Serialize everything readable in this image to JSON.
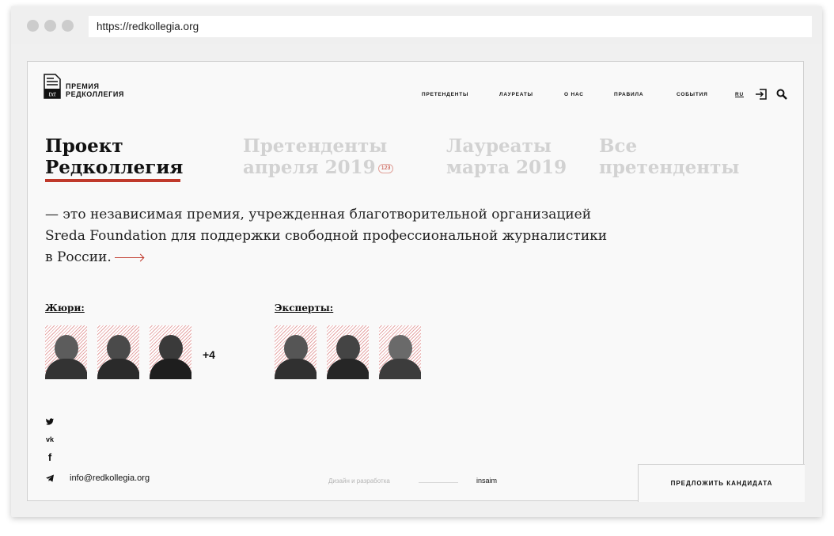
{
  "browser": {
    "url": "https://redkollegia.org"
  },
  "logo": {
    "line1": "ПРЕМИЯ",
    "line2": "РЕДКОЛЛЕГИЯ",
    "mark": "txt"
  },
  "nav": {
    "items": [
      "ПРЕТЕНДЕНТЫ",
      "ЛАУРЕАТЫ",
      "О НАС",
      "ПРАВИЛА",
      "СОБЫТИЯ"
    ],
    "lang": "RU"
  },
  "tabs": [
    {
      "line1": "Проект",
      "line2": "Редколлегия"
    },
    {
      "line1": "Претенденты",
      "line2": "апреля 2019",
      "badge": "123"
    },
    {
      "line1": "Лауреаты",
      "line2": "марта 2019"
    },
    {
      "line1": "Все",
      "line2": "претенденты"
    }
  ],
  "intro": {
    "line1": "— это независимая премия, учрежденная благотворительной организацией",
    "line2": "Sreda Foundation для поддержки свободной профессиональной журналистики",
    "line3": "в России."
  },
  "jury": {
    "label": "Жюри:",
    "more": "+4"
  },
  "experts": {
    "label": "Эксперты:"
  },
  "social": {
    "twitter": "twitter-icon",
    "vk": "vk-icon",
    "facebook": "facebook-icon",
    "telegram": "telegram-icon"
  },
  "footer": {
    "email": "info@redkollegia.org",
    "design_label": "Дизайн и разработка",
    "design_name": "insaim",
    "cta": "ПРЕДЛОЖИТЬ КАНДИДАТА"
  },
  "colors": {
    "accent": "#c0392b",
    "text": "#111111",
    "inactive_tab": "#d2d2d2"
  }
}
